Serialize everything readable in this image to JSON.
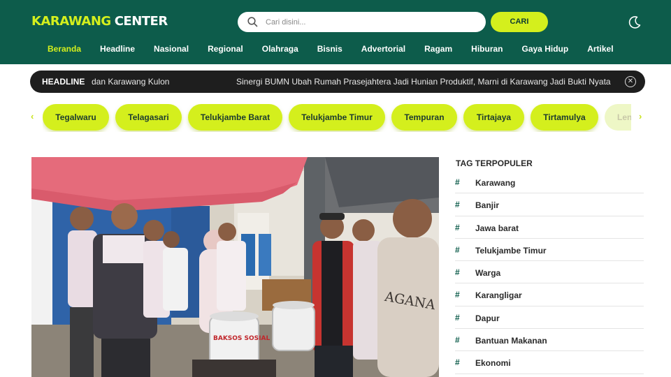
{
  "header": {
    "logo_part1": "KARAWANG",
    "logo_part2": "CENTER",
    "search_placeholder": "Cari disini...",
    "search_button": "CARI",
    "theme_icon": "moon-icon"
  },
  "nav": {
    "items": [
      "Beranda",
      "Headline",
      "Nasional",
      "Regional",
      "Olahraga",
      "Bisnis",
      "Advertorial",
      "Ragam",
      "Hiburan",
      "Gaya Hidup",
      "Artikel"
    ],
    "active": "Beranda"
  },
  "ticker": {
    "label": "HEADLINE",
    "text1": "dan Karawang Kulon",
    "text2": "Sinergi BUMN Ubah Rumah Prasejahtera Jadi Hunian Produktif, Marni di Karawang Jadi Bukti Nyata",
    "close_icon": "close-circle-icon"
  },
  "chips": {
    "items": [
      "Tegalwaru",
      "Telagasari",
      "Telukjambe Barat",
      "Telukjambe Timur",
      "Tempuran",
      "Tirtajaya",
      "Tirtamulya",
      "Len"
    ],
    "prev_icon": "chevron-left-icon",
    "next_icon": "chevron-right-icon"
  },
  "photo": {
    "pot_text": "BAKSOS SOSIAL AGANA",
    "shirt_text": "AGANA"
  },
  "sidebar": {
    "title": "TAG TERPOPULER",
    "tags": [
      "Karawang",
      "Banjir",
      "Jawa barat",
      "Telukjambe Timur",
      "Warga",
      "Karangligar",
      "Dapur",
      "Bantuan Makanan",
      "Ekonomi"
    ]
  },
  "colors": {
    "header_bg": "#0d5c4b",
    "accent": "#d4ef1d",
    "ticker_bg": "#1e1e1e"
  }
}
